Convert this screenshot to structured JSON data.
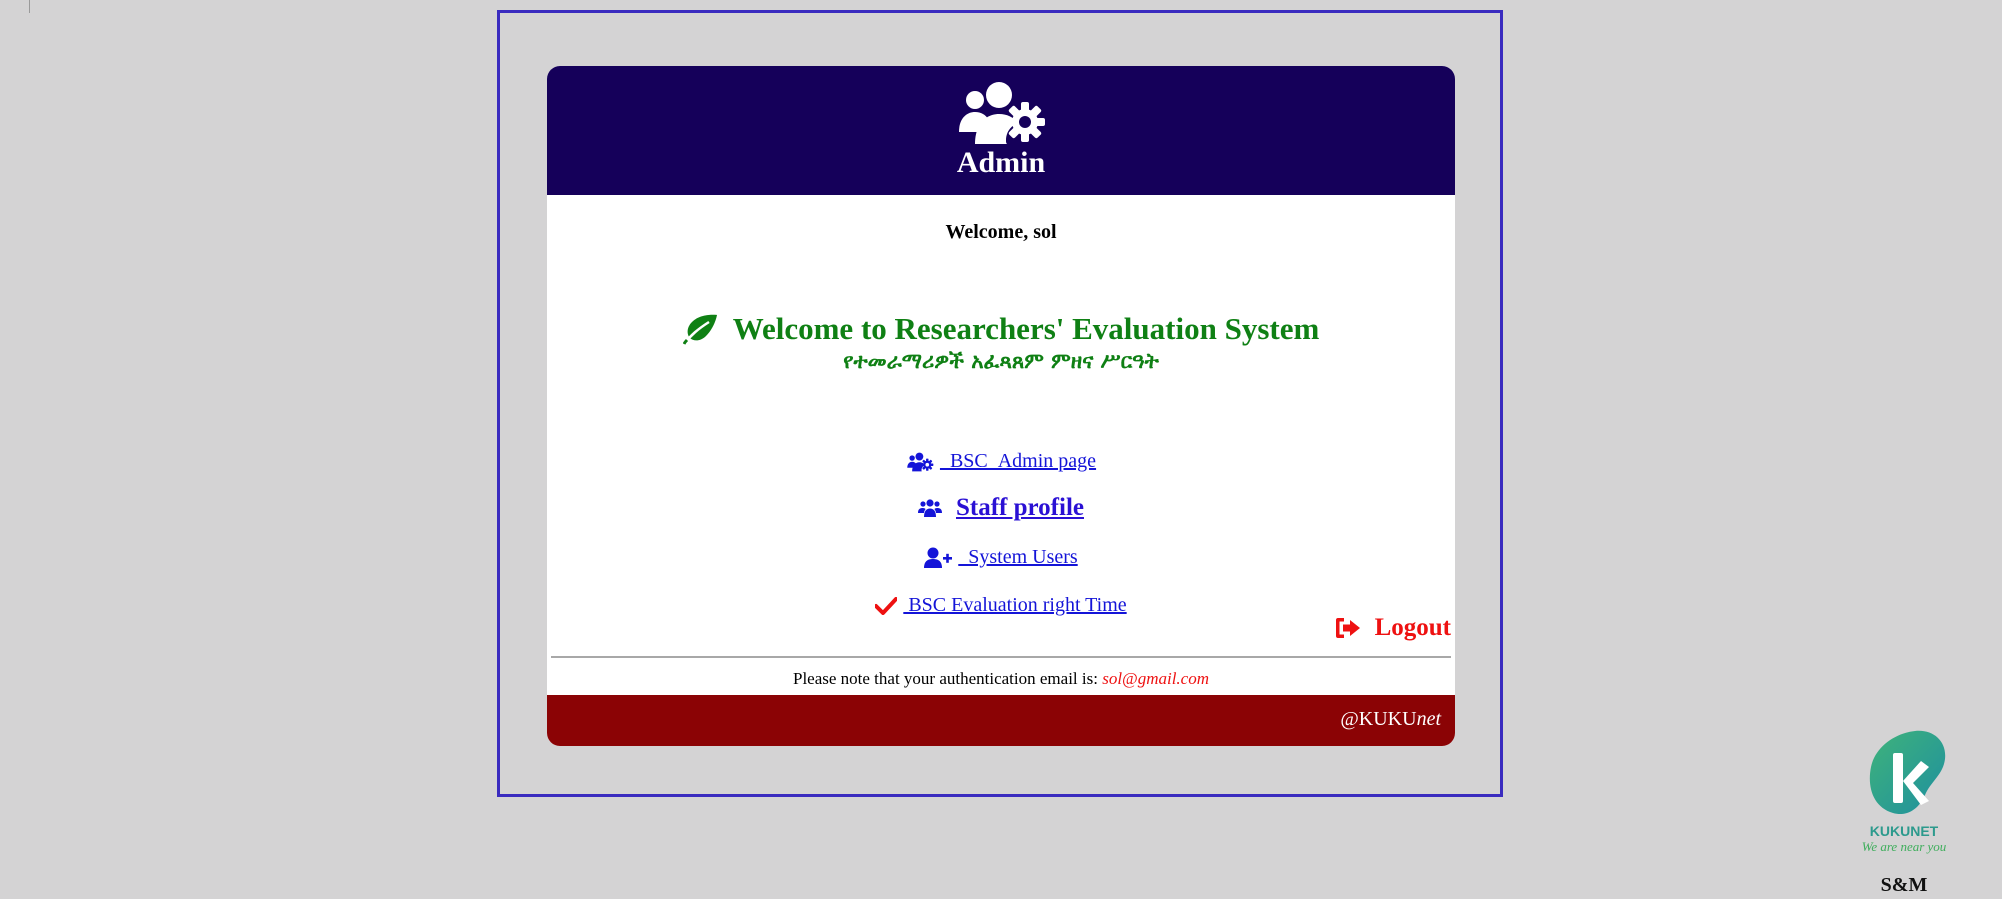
{
  "header": {
    "title": "Admin",
    "icon": "users-gear-icon",
    "background_color": "#15005a"
  },
  "welcome_user": "Welcome, sol",
  "system": {
    "title": "Welcome to Researchers' Evaluation System",
    "subtitle": "የተመራማሪዎች አፈጻጸም ምዘና ሥርዓት",
    "icon": "leaf-icon",
    "color": "#0f8014"
  },
  "nav": {
    "admin_page": "  BSC_Admin page",
    "staff_profile": "Staff profile",
    "system_users": "  System Users",
    "evaluation_time": " BSC Evaluation right Time"
  },
  "logout_label": "Logout",
  "auth": {
    "note": "Please note that your authentication email is: ",
    "email": "sol@gmail.com"
  },
  "footer": {
    "brand_main": "@KUKU",
    "brand_italic": "net",
    "background_color": "#8b0305"
  },
  "logo": {
    "name": "KUKUNET",
    "tagline": "We are near you",
    "caption": "S&M"
  }
}
